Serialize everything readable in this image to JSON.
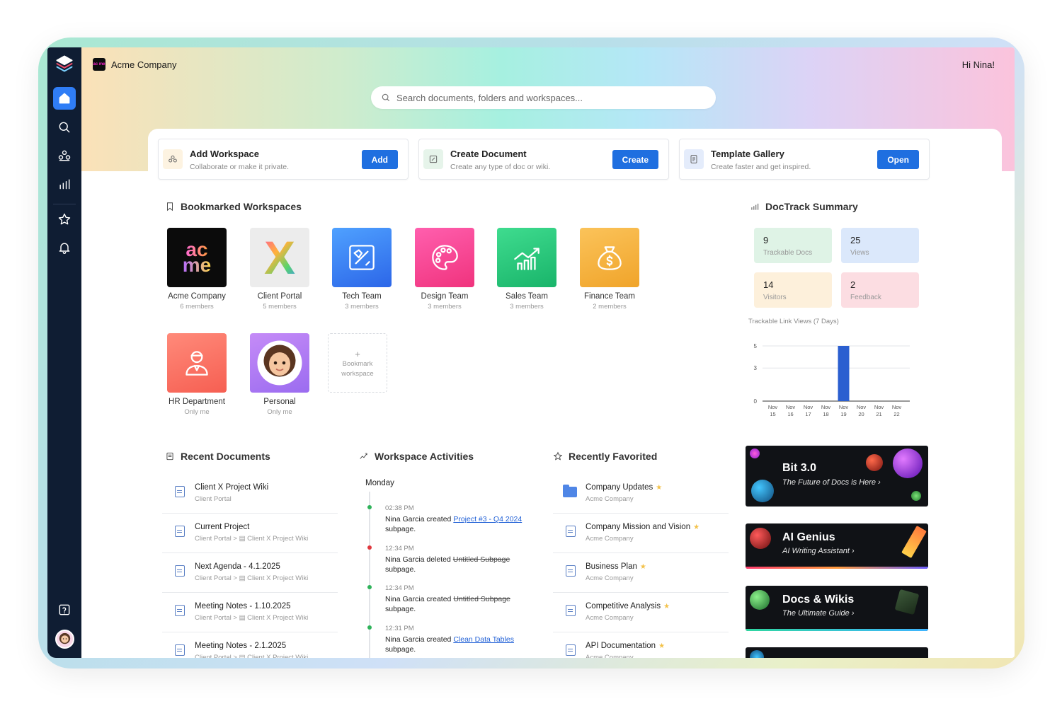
{
  "header": {
    "company": "Acme Company",
    "greeting": "Hi Nina!",
    "logo_text": "ac me"
  },
  "search": {
    "placeholder": "Search documents, folders and workspaces..."
  },
  "sidebar": {
    "items": [
      "home-icon",
      "search-icon",
      "workspaces-icon",
      "analytics-icon",
      "star-icon",
      "bell-icon",
      "help-icon"
    ]
  },
  "quick_actions": [
    {
      "title": "Add Workspace",
      "subtitle": "Collaborate or make it private.",
      "button": "Add"
    },
    {
      "title": "Create Document",
      "subtitle": "Create any type of doc or wiki.",
      "button": "Create"
    },
    {
      "title": "Template Gallery",
      "subtitle": "Create faster and get inspired.",
      "button": "Open"
    }
  ],
  "bookmarked": {
    "title": "Bookmarked Workspaces",
    "add_label_1": "+",
    "add_label_2": "Bookmark",
    "add_label_3": "workspace",
    "items": [
      {
        "name": "Acme Company",
        "meta": "6 members"
      },
      {
        "name": "Client Portal",
        "meta": "5 members"
      },
      {
        "name": "Tech Team",
        "meta": "3 members"
      },
      {
        "name": "Design Team",
        "meta": "3 members"
      },
      {
        "name": "Sales Team",
        "meta": "3 members"
      },
      {
        "name": "Finance Team",
        "meta": "2 members"
      },
      {
        "name": "HR Department",
        "meta": "Only me"
      },
      {
        "name": "Personal",
        "meta": "Only me"
      }
    ],
    "acme_tile_text_1": "ac",
    "acme_tile_text_2": "me",
    "client_tile_text": "X"
  },
  "doctrack": {
    "title": "DocTrack Summary",
    "stats": [
      {
        "value": "9",
        "label": "Trackable Docs",
        "color": "#dff3e6"
      },
      {
        "value": "25",
        "label": "Views",
        "color": "#dbe8fb"
      },
      {
        "value": "14",
        "label": "Visitors",
        "color": "#fdf0db"
      },
      {
        "value": "2",
        "label": "Feedback",
        "color": "#fcdde2"
      }
    ],
    "chart_title": "Trackable Link Views (7 Days)"
  },
  "chart_data": {
    "type": "bar",
    "title": "Trackable Link Views (7 Days)",
    "categories": [
      "Nov 15",
      "Nov 16",
      "Nov 17",
      "Nov 18",
      "Nov 19",
      "Nov 20",
      "Nov 21",
      "Nov 22"
    ],
    "values": [
      0,
      0,
      0,
      0,
      5,
      0,
      0,
      0
    ],
    "yticks": [
      0,
      3,
      5
    ],
    "ylim": [
      0,
      5
    ],
    "grid": true,
    "color": "#2b5fd0"
  },
  "recent": {
    "title": "Recent Documents",
    "items": [
      {
        "title": "Client X Project Wiki",
        "path": "Client Portal"
      },
      {
        "title": "Current Project",
        "path": "Client Portal >  ▤  Client X Project Wiki"
      },
      {
        "title": "Next Agenda - 4.1.2025",
        "path": "Client Portal >  ▤  Client X Project Wiki"
      },
      {
        "title": "Meeting Notes - 1.10.2025",
        "path": "Client Portal >  ▤  Client X Project Wiki"
      },
      {
        "title": "Meeting Notes - 2.1.2025",
        "path": "Client Portal >  ▤  Client X Project Wiki"
      }
    ]
  },
  "activities": {
    "title": "Workspace Activities",
    "day": "Monday",
    "items": [
      {
        "time": "02:38 PM",
        "actor": "Nina Garcia",
        "verb": "created",
        "target": "Project #3 - Q4 2024",
        "suffix": "subpage.",
        "kind": "link",
        "color": "#2fb35a"
      },
      {
        "time": "12:34 PM",
        "actor": "Nina Garcia",
        "verb": "deleted",
        "target": "Untitled Subpage",
        "suffix": "subpage.",
        "kind": "strike",
        "color": "#e0383e"
      },
      {
        "time": "12:34 PM",
        "actor": "Nina Garcia",
        "verb": "created",
        "target": "Untitled Subpage",
        "suffix": "subpage.",
        "kind": "strike",
        "color": "#2fb35a"
      },
      {
        "time": "12:31 PM",
        "actor": "Nina Garcia",
        "verb": "created",
        "target": "Clean Data Tables",
        "suffix": "subpage.",
        "kind": "link",
        "color": "#2fb35a"
      }
    ]
  },
  "favorites": {
    "title": "Recently Favorited",
    "items": [
      {
        "title": "Company Updates",
        "path": "Acme Company",
        "icon": "folder"
      },
      {
        "title": "Company Mission and Vision",
        "path": "Acme Company",
        "icon": "doc"
      },
      {
        "title": "Business Plan",
        "path": "Acme Company",
        "icon": "doc"
      },
      {
        "title": "Competitive Analysis",
        "path": "Acme Company",
        "icon": "doc"
      },
      {
        "title": "API Documentation",
        "path": "Acme Company",
        "icon": "doc"
      }
    ],
    "star": "★"
  },
  "promos": [
    {
      "title": "Bit 3.0",
      "subtitle": "The Future of Docs is Here  ›"
    },
    {
      "title": "AI Genius",
      "subtitle": "AI Writing Assistant  ›"
    },
    {
      "title": "Docs & Wikis",
      "subtitle": "The Ultimate Guide  ›"
    }
  ]
}
